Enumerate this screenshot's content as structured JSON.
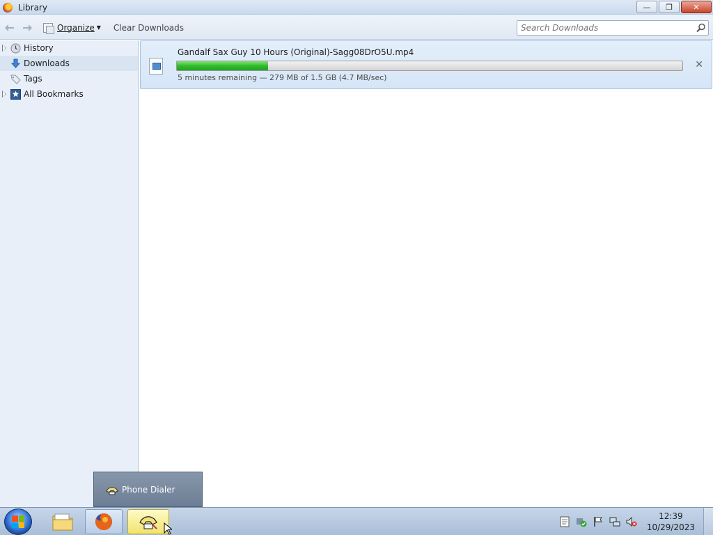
{
  "window": {
    "title": "Library",
    "controls": {
      "minimize": "—",
      "restore": "❐",
      "close": "✕"
    }
  },
  "toolbar": {
    "back_icon": "back-arrow-icon",
    "forward_icon": "forward-arrow-icon",
    "organize_label": "Organize",
    "clear_downloads_label": "Clear Downloads",
    "search_placeholder": "Search Downloads"
  },
  "sidebar": {
    "items": [
      {
        "label": "History",
        "icon": "clock-icon",
        "expandable": true
      },
      {
        "label": "Downloads",
        "icon": "download-arrow-icon",
        "expandable": false,
        "selected": true
      },
      {
        "label": "Tags",
        "icon": "tag-icon",
        "expandable": false
      },
      {
        "label": "All Bookmarks",
        "icon": "star-icon",
        "expandable": true
      }
    ]
  },
  "downloads": [
    {
      "filename": "Gandalf Sax Guy 10 Hours (Original)-Sagg08DrO5U.mp4",
      "status": "5 minutes remaining — 279 MB of 1.5 GB (4.7 MB/sec)",
      "progress": 0.18,
      "cancel_icon": "✕"
    }
  ],
  "jumplist": {
    "items": [
      {
        "label": "Phone Dialer",
        "icon": "phone-dialer-icon"
      }
    ]
  },
  "taskbar": {
    "clock_time": "12:39",
    "clock_date": "10/29/2023",
    "colors": {
      "accent": "#2d6fd2",
      "progress": "#2fbd2a"
    }
  }
}
